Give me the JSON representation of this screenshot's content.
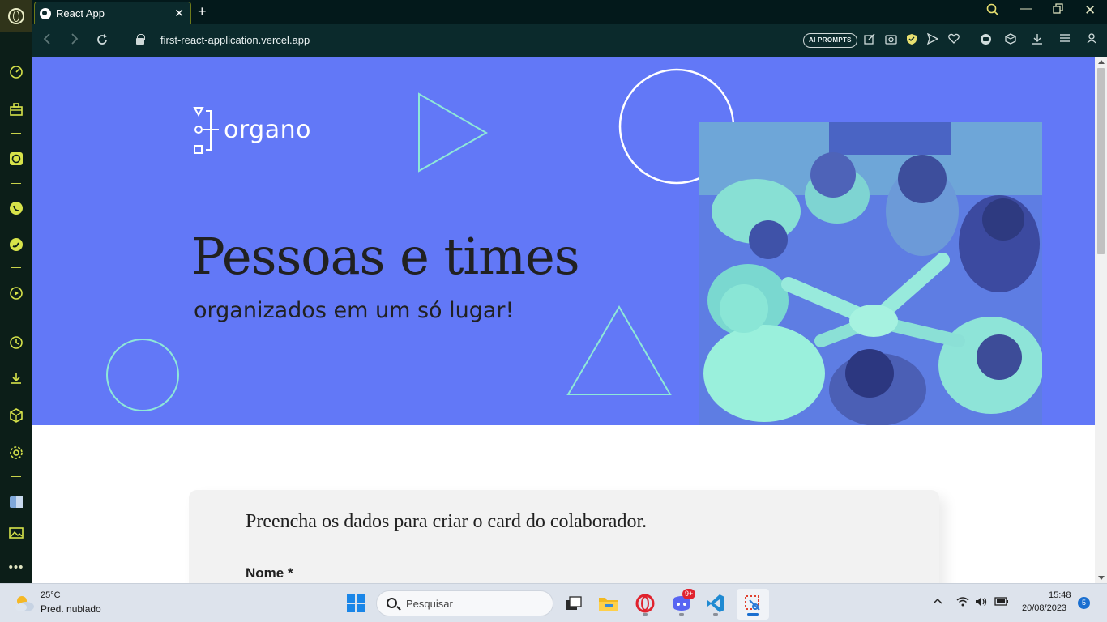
{
  "browser": {
    "tab_title": "React App",
    "new_tab_symbol": "+",
    "url_host": "first-react-application.vercel.app",
    "ai_prompts_label": "AI PROMPTS",
    "accent_color": "#d7e34a"
  },
  "hero": {
    "logo_text": "organo",
    "title": "Pessoas e times",
    "subtitle": "organizados em um só lugar!",
    "background_color": "#6278f7",
    "shape_color": "#8ee8d8"
  },
  "form": {
    "title": "Preencha os dados para criar o card do colaborador.",
    "first_label": "Nome *"
  },
  "taskbar": {
    "weather_temp": "25°C",
    "weather_desc": "Pred. nublado",
    "search_placeholder": "Pesquisar",
    "discord_badge": "9+",
    "time": "15:48",
    "date": "20/08/2023",
    "notifications": "5"
  }
}
